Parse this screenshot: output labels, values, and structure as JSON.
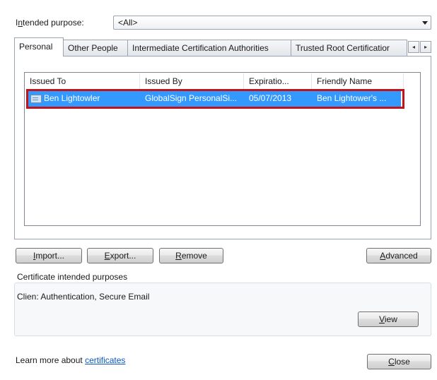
{
  "intended_purpose": {
    "label_prefix": "I",
    "label_accesskey": "n",
    "label_suffix": "tended purpose:",
    "value": "<All>"
  },
  "tabs": [
    {
      "label": "Personal",
      "active": true
    },
    {
      "label": "Other People",
      "active": false
    },
    {
      "label": "Intermediate Certification Authorities",
      "active": false
    },
    {
      "label": "Trusted Root Certificatior",
      "active": false
    }
  ],
  "tab_scroll": {
    "left": "◂",
    "right": "▸"
  },
  "list": {
    "columns": [
      "Issued To",
      "Issued By",
      "Expiratio...",
      "Friendly Name"
    ],
    "rows": [
      {
        "issued_to": "Ben Lightowler",
        "issued_by": "GlobalSign PersonalSi...",
        "expiration": "05/07/2013",
        "friendly_name": "Ben Lightower's ...",
        "selected": true,
        "icon": "certificate-icon"
      }
    ]
  },
  "buttons": {
    "import": {
      "pre": "",
      "key": "I",
      "post": "mport..."
    },
    "export": {
      "pre": "",
      "key": "E",
      "post": "xport..."
    },
    "remove": {
      "pre": "",
      "key": "R",
      "post": "emove"
    },
    "advanced": {
      "pre": "",
      "key": "A",
      "post": "dvanced"
    },
    "view": {
      "pre": "",
      "key": "V",
      "post": "iew"
    },
    "close": {
      "pre": "",
      "key": "C",
      "post": "lose"
    }
  },
  "purposes_group": {
    "title": "Certificate intended purposes",
    "text": "Clien: Authentication, Secure Email"
  },
  "footer": {
    "learn_more": "Learn more about ",
    "link": "certificates"
  },
  "colors": {
    "selection": "#3399ff",
    "highlight_outline": "#c0141c",
    "link": "#0b57c2"
  }
}
